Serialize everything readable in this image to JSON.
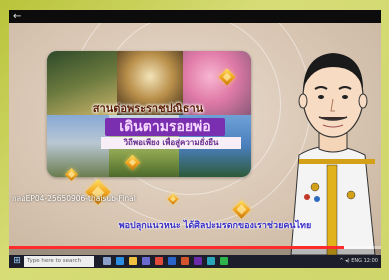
{
  "player": {
    "back_icon": "←"
  },
  "video": {
    "title_line": "สานต่อพระราชปณิธาน",
    "headline": "เดินตามรอยพ่อ",
    "subline": "วิถีพอเพียง เพื่อสู่ความยั่งยืน",
    "caption": "กลอEP04-25650906-thaisub-Final",
    "subtitle": "พอปลุกแนวหนะ ได้ศิลปะมรดกของเราช่วยคนไทย",
    "progress_fraction": 0.9
  },
  "taskbar": {
    "start_icon": "windows-icon",
    "search_placeholder": "Type here to search",
    "tray_text": "^ ◂) ENG 12:00"
  },
  "colors": {
    "headline_bg": "#7a2fb0",
    "subtitle_text": "#3b31c6",
    "progress": "#ff2b2b",
    "taskbar": "#1c1f2b"
  }
}
